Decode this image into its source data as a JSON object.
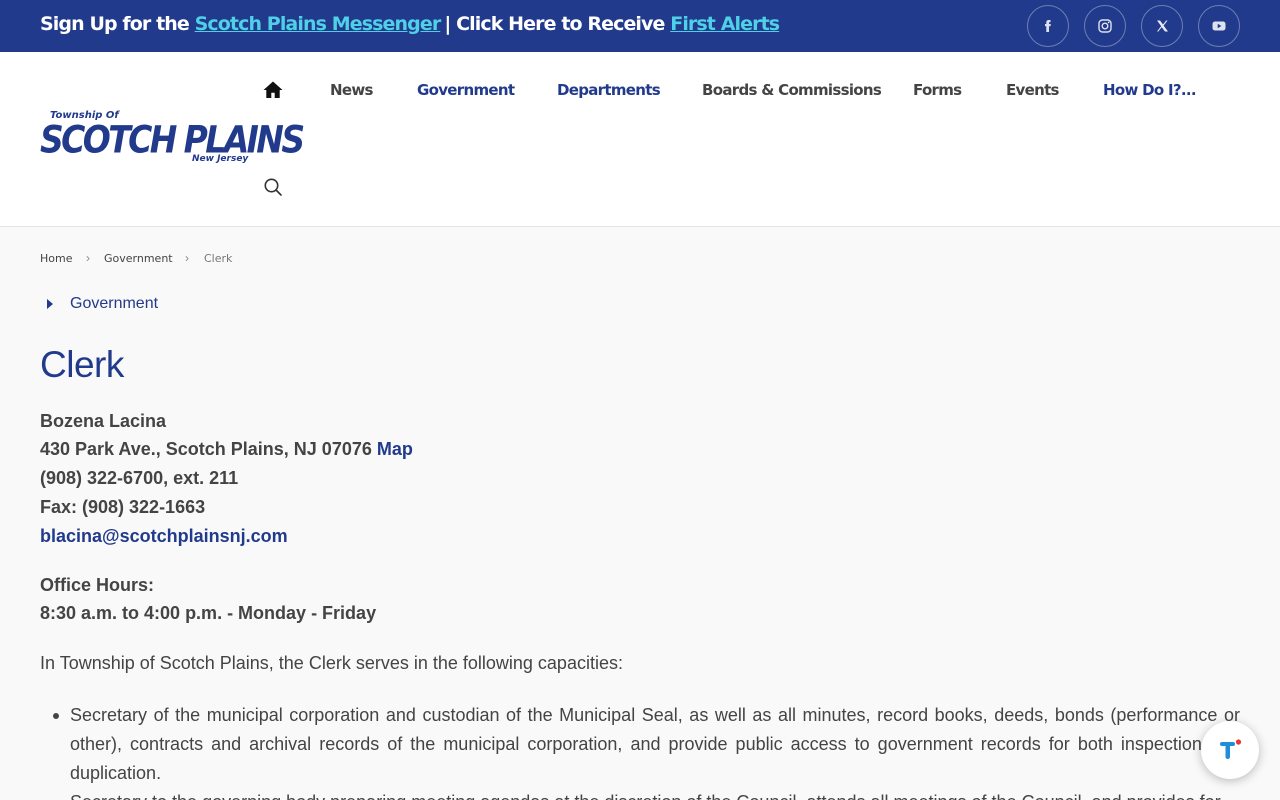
{
  "topbar": {
    "signup_prefix": "Sign Up for the ",
    "messenger_link": "Scotch Plains Messenger",
    "separator": "| ",
    "receive_prefix": " Click Here to Receive ",
    "alerts_link": "First Alerts"
  },
  "social": [
    "facebook-icon",
    "instagram-icon",
    "x-icon",
    "youtube-icon"
  ],
  "logo": {
    "line1": "Township Of",
    "line2": "SCOTCH PLAINS",
    "line3": "New Jersey"
  },
  "nav": {
    "news": "News",
    "government": "Government",
    "departments": "Departments",
    "boards": "Boards & Commissions",
    "forms": "Forms",
    "events": "Events",
    "how": "How Do I?..."
  },
  "breadcrumb": {
    "home": "Home",
    "government": "Government",
    "current": "Clerk"
  },
  "sidenav": {
    "label": "Government"
  },
  "page": {
    "title": "Clerk",
    "name": "Bozena Lacina",
    "address": "430 Park Ave., Scotch Plains, NJ 07076 ",
    "map_link": "Map",
    "phone": "(908) 322-6700, ext. 211",
    "fax": "Fax: (908) 322-1663",
    "email": "blacina@scotchplainsnj.com",
    "hours_label": "Office Hours:",
    "hours": "8:30 a.m. to 4:00 p.m. - Monday - Friday",
    "intro": "In Township of Scotch Plains, the Clerk serves in the following capacities:",
    "bullets": [
      "Secretary of the municipal corporation and custodian of the Municipal Seal, as well as all minutes, record books, deeds, bonds (performance or other), contracts and archival records of the municipal corporation, and provide public access to government records for both inspection and duplication.",
      "Secretary to the governing body preparing meeting agendas at the discretion of the Council, attends all meetings of the Council, and provides for"
    ]
  },
  "colors": {
    "brand": "#213a8c",
    "accent": "#4fd0e6"
  }
}
